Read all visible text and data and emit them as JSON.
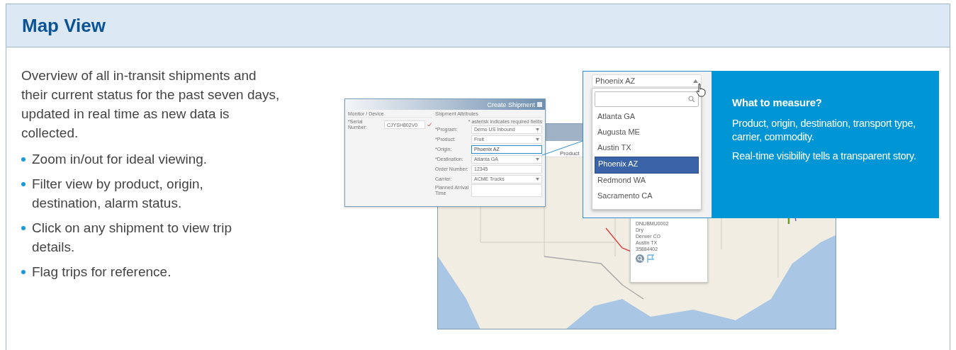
{
  "header": {
    "title": "Map View"
  },
  "intro": "Overview of all in-transit shipments and their current status for the past seven days, updated in real time as new data is collected.",
  "bullets": [
    "Zoom in/out for ideal viewing.",
    "Filter view by product, origin, destination, alarm status.",
    "Click on any shipment to view trip details.",
    "Flag trips for reference."
  ],
  "shipment_form": {
    "title": "Create Shipment",
    "device_section": "Monitor / Device",
    "attributes_section": "Shipment Attributes",
    "required_note": "* asterisk indicates required fields",
    "device_fields": [
      {
        "label": "*Serial Number:",
        "value": "CJYSH802V0",
        "kind": "text",
        "highlighted": false
      }
    ],
    "attribute_fields": [
      {
        "label": "*Program:",
        "value": "Demo US Inbound",
        "kind": "select",
        "highlighted": false
      },
      {
        "label": "*Product:",
        "value": "Fruit",
        "kind": "select",
        "highlighted": false
      },
      {
        "label": "*Origin:",
        "value": "Phoenix AZ",
        "kind": "text",
        "highlighted": true
      },
      {
        "label": "*Destination:",
        "value": "Atlanta GA",
        "kind": "select",
        "highlighted": false
      },
      {
        "label": "Order Number:",
        "value": "12345",
        "kind": "text",
        "highlighted": false
      },
      {
        "label": "Carrier:",
        "value": "ACME Trucks",
        "kind": "select",
        "highlighted": false
      },
      {
        "label": "Planned Arrival Time",
        "kind": "textarea",
        "highlighted": false
      }
    ]
  },
  "map": {
    "column_header": "Product",
    "popup": {
      "lines": [
        "DNUBMU0002",
        "Dry",
        "Denver CO",
        "Austin TX",
        "35884402"
      ]
    }
  },
  "dropdown": {
    "value": "Phoenix AZ",
    "options": [
      {
        "label": "Atlanta GA",
        "selected": false
      },
      {
        "label": "Augusta ME",
        "selected": false
      },
      {
        "label": "Austin TX",
        "selected": false
      },
      {
        "label": "Phoenix AZ",
        "selected": true
      },
      {
        "label": "Redmond WA",
        "selected": false
      },
      {
        "label": "Sacramento CA",
        "selected": false
      }
    ]
  },
  "callout": {
    "title": "What to measure?",
    "paragraphs": [
      "Product, origin, destination, transport type, carrier, commodity.",
      "Real-time visibility tells a transparent story."
    ]
  }
}
